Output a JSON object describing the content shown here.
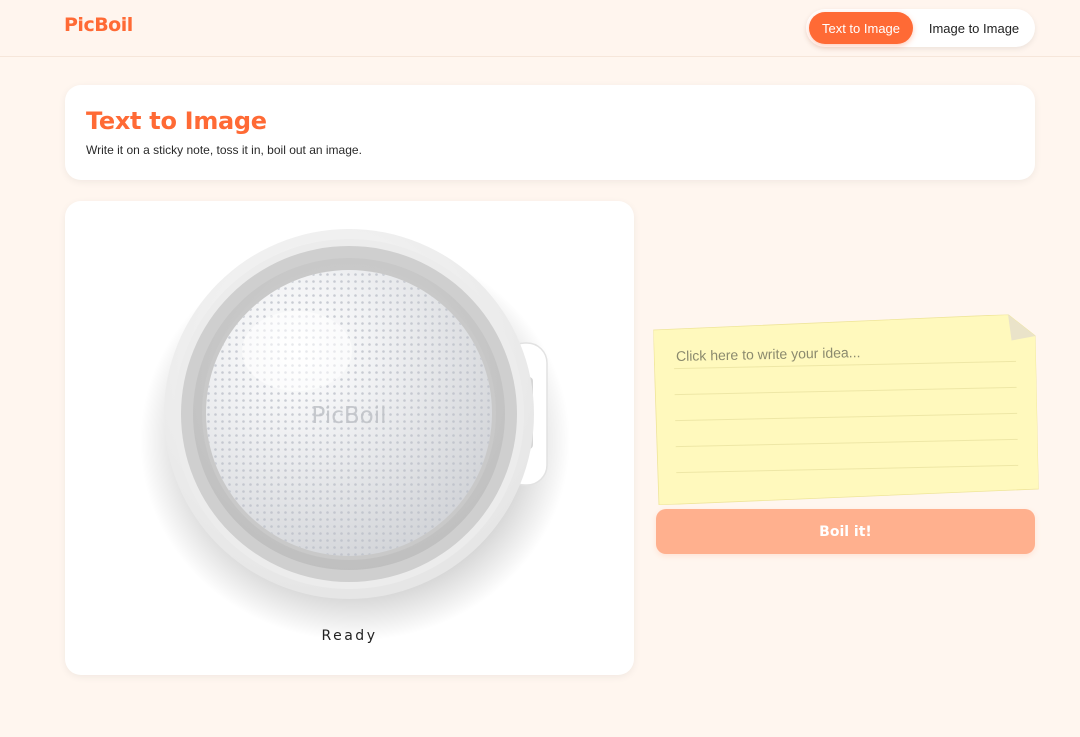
{
  "app": {
    "logo": "PicBoil"
  },
  "nav": {
    "modes": [
      {
        "label": "Text to Image",
        "active": true
      },
      {
        "label": "Image to Image",
        "active": false
      }
    ]
  },
  "header": {
    "title": "Text to Image",
    "subtitle": "Write it on a sticky note, toss it in, boil out an image."
  },
  "pot": {
    "watermark": "PicBoil",
    "status": "Ready"
  },
  "note": {
    "placeholder": "Click here to write your idea..."
  },
  "actions": {
    "boil_label": "Boil it!"
  },
  "colors": {
    "accent": "#ff6a35",
    "background": "#fff6ef",
    "note": "#fff9bd",
    "button_disabled": "#ffb08e"
  }
}
